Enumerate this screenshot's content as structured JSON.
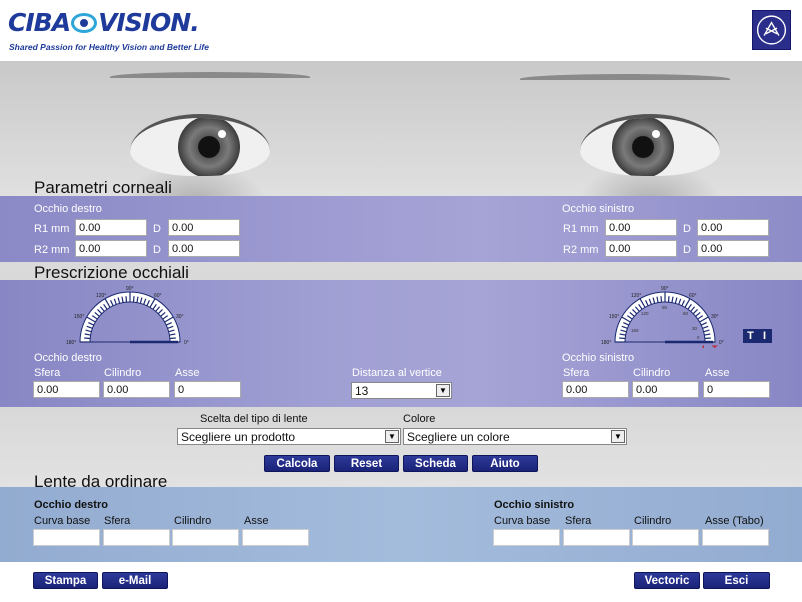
{
  "header": {
    "brand": "CIBA",
    "brand2": "VISION.",
    "tagline": "Shared Passion for Healthy Vision and Better Life"
  },
  "corneal": {
    "title": "Parametri corneali",
    "right": {
      "label": "Occhio destro",
      "r1_label": "R1 mm",
      "r2_label": "R2 mm",
      "d_label": "D",
      "r1_mm": "0.00",
      "r1_d": "0.00",
      "r2_mm": "0.00",
      "r2_d": "0.00"
    },
    "left": {
      "label": "Occhio sinistro",
      "r1_label": "R1 mm",
      "r2_label": "R2 mm",
      "d_label": "D",
      "r1_mm": "0.00",
      "r1_d": "0.00",
      "r2_mm": "0.00",
      "r2_d": "0.00"
    }
  },
  "prescription": {
    "title": "Prescrizione occhiali",
    "right": {
      "label": "Occhio destro",
      "sfera_label": "Sfera",
      "cilindro_label": "Cilindro",
      "asse_label": "Asse",
      "sfera": "0.00",
      "cilindro": "0.00",
      "asse": "0"
    },
    "left": {
      "label": "Occhio sinistro",
      "sfera_label": "Sfera",
      "cilindro_label": "Cilindro",
      "asse_label": "Asse",
      "sfera": "0.00",
      "cilindro": "0.00",
      "asse": "0"
    },
    "vertex_label": "Distanza al vertice",
    "vertex_value": "13",
    "axis_marks": [
      "180°",
      "150°",
      "120°",
      "90°",
      "60°",
      "30°",
      "0°"
    ],
    "left_inner_marks": [
      "150",
      "120",
      "90",
      "60",
      "30",
      "0"
    ],
    "left_letters": [
      "I",
      "T"
    ],
    "ti_buttons": [
      "T",
      "I"
    ]
  },
  "lens_choice": {
    "type_label": "Scelta del tipo di lente",
    "type_value": "Scegliere un prodotto",
    "color_label": "Colore",
    "color_value": "Scegliere un colore",
    "buttons": [
      "Calcola",
      "Reset",
      "Scheda",
      "Aiuto"
    ]
  },
  "order": {
    "title": "Lente da ordinare",
    "right": {
      "label": "Occhio destro",
      "cols": [
        "Curva base",
        "Sfera",
        "Cilindro",
        "Asse"
      ]
    },
    "left": {
      "label": "Occhio sinistro",
      "cols": [
        "Curva base",
        "Sfera",
        "Cilindro",
        "Asse (Tabo)"
      ]
    }
  },
  "footer": {
    "stampa": "Stampa",
    "email": "e-Mail",
    "vectoric": "Vectoric",
    "esci": "Esci"
  },
  "colors": {
    "accent": "#1e3a9a",
    "button": "#232d86",
    "band_purple": "#9d9bd1",
    "band_blue": "#a4bcdc"
  }
}
